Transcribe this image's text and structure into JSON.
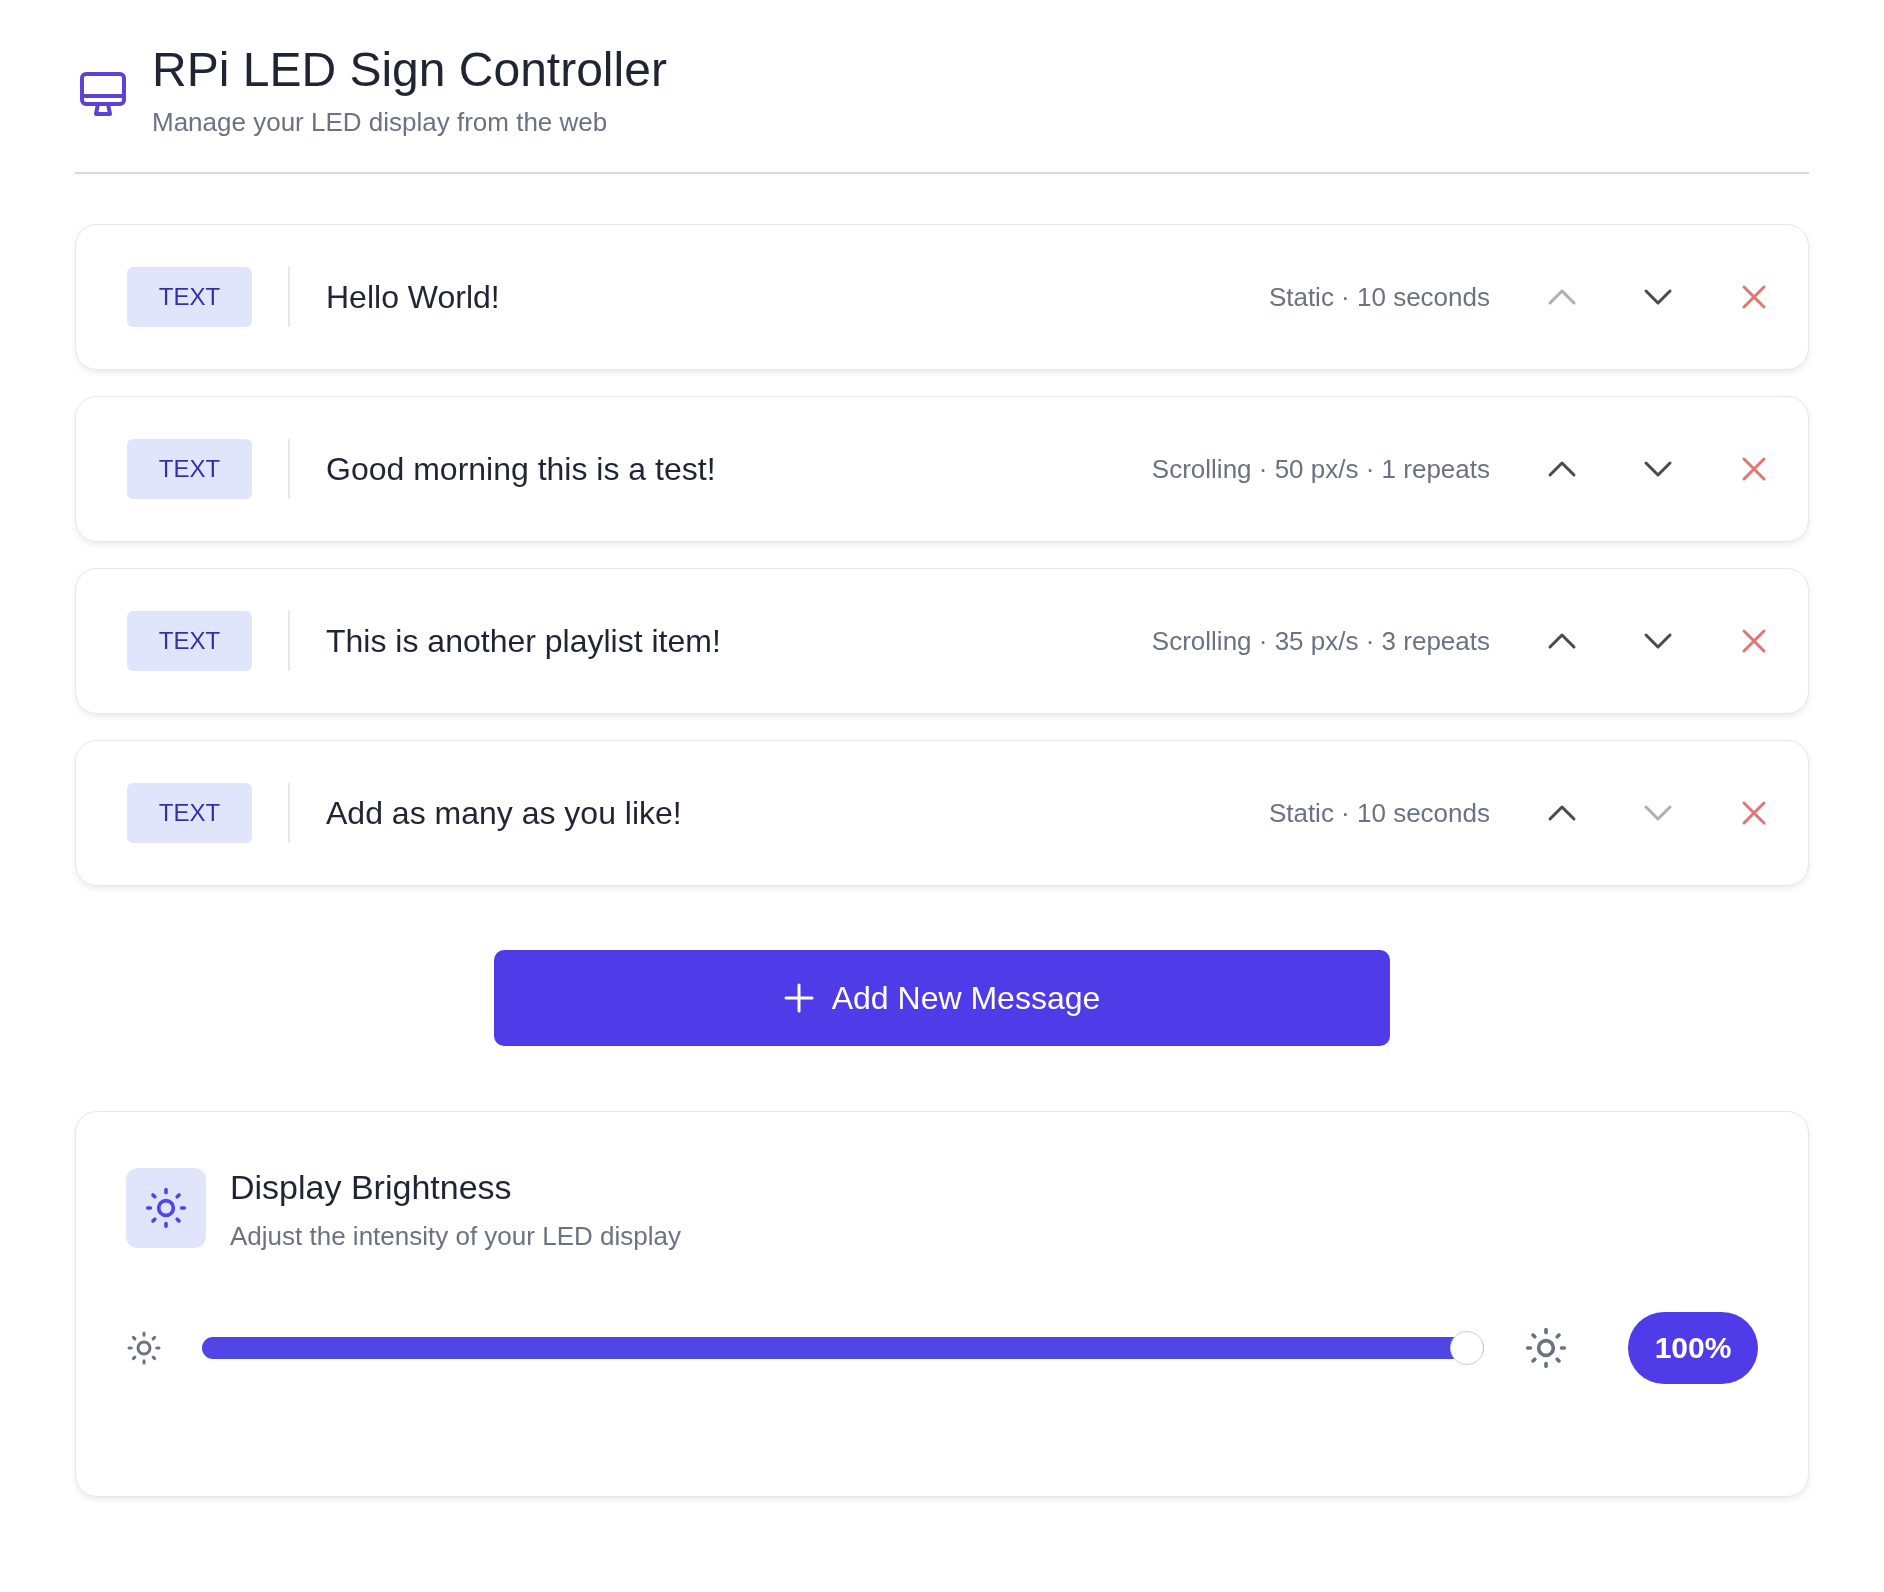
{
  "header": {
    "title": "RPi LED Sign Controller",
    "subtitle": "Manage your LED display from the web"
  },
  "messages": [
    {
      "type": "TEXT",
      "text": "Hello World!",
      "details": "Static · 10 seconds",
      "up_disabled": true,
      "down_disabled": false
    },
    {
      "type": "TEXT",
      "text": "Good morning this is a test!",
      "details": "Scrolling · 50 px/s · 1 repeats",
      "up_disabled": false,
      "down_disabled": false
    },
    {
      "type": "TEXT",
      "text": "This is another playlist item!",
      "details": "Scrolling · 35 px/s · 3 repeats",
      "up_disabled": false,
      "down_disabled": false
    },
    {
      "type": "TEXT",
      "text": "Add as many as you like!",
      "details": "Static · 10 seconds",
      "up_disabled": false,
      "down_disabled": true
    }
  ],
  "add_button": {
    "label": "Add New Message"
  },
  "brightness": {
    "title": "Display Brightness",
    "subtitle": "Adjust the intensity of your LED display",
    "level": 1,
    "reading": "100%"
  }
}
